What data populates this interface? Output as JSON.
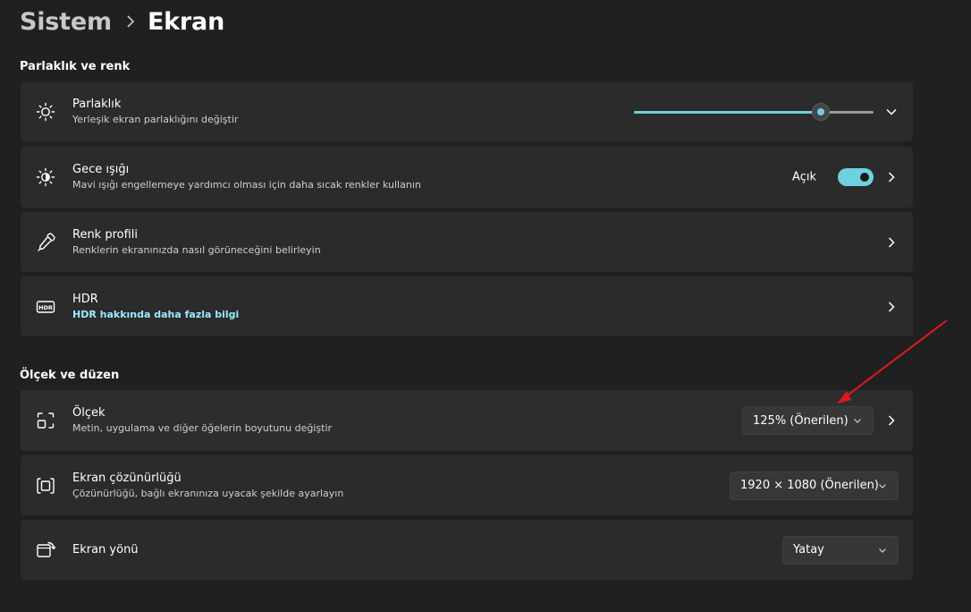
{
  "breadcrumb": {
    "parent": "Sistem",
    "current": "Ekran"
  },
  "sections": {
    "brightness_color": "Parlaklık ve renk",
    "scale_layout": "Ölçek ve düzen"
  },
  "brightness": {
    "title": "Parlaklık",
    "subtitle": "Yerleşik ekran parlaklığını değiştir",
    "level_percent": 78,
    "icon": "sun-icon"
  },
  "night_light": {
    "title": "Gece ışığı",
    "subtitle": "Mavi ışığı engellemeye yardımcı olması için daha sıcak renkler kullanın",
    "toggle_label": "Açık",
    "toggle_on": true,
    "icon": "night-light-icon"
  },
  "color_profile": {
    "title": "Renk profili",
    "subtitle": "Renklerin ekranınızda nasıl görüneceğini belirleyin",
    "icon": "eyedropper-icon"
  },
  "hdr": {
    "title": "HDR",
    "link": "HDR hakkında daha fazla bilgi",
    "icon": "hdr-icon"
  },
  "scale": {
    "title": "Ölçek",
    "subtitle": "Metin, uygulama ve diğer öğelerin boyutunu değiştir",
    "value": "125% (Önerilen)",
    "icon": "scale-icon"
  },
  "resolution": {
    "title": "Ekran çözünürlüğü",
    "subtitle": "Çözünürlüğü, bağlı ekranınıza uyacak şekilde ayarlayın",
    "value": "1920 × 1080 (Önerilen)",
    "icon": "resolution-icon"
  },
  "orientation": {
    "title": "Ekran yönü",
    "value": "Yatay",
    "icon": "orientation-icon"
  },
  "colors": {
    "accent": "#6fd0e0",
    "link": "#99ebff",
    "card_bg": "#2b2b2b",
    "page_bg": "#202020",
    "annotation_arrow": "#e0191b"
  }
}
